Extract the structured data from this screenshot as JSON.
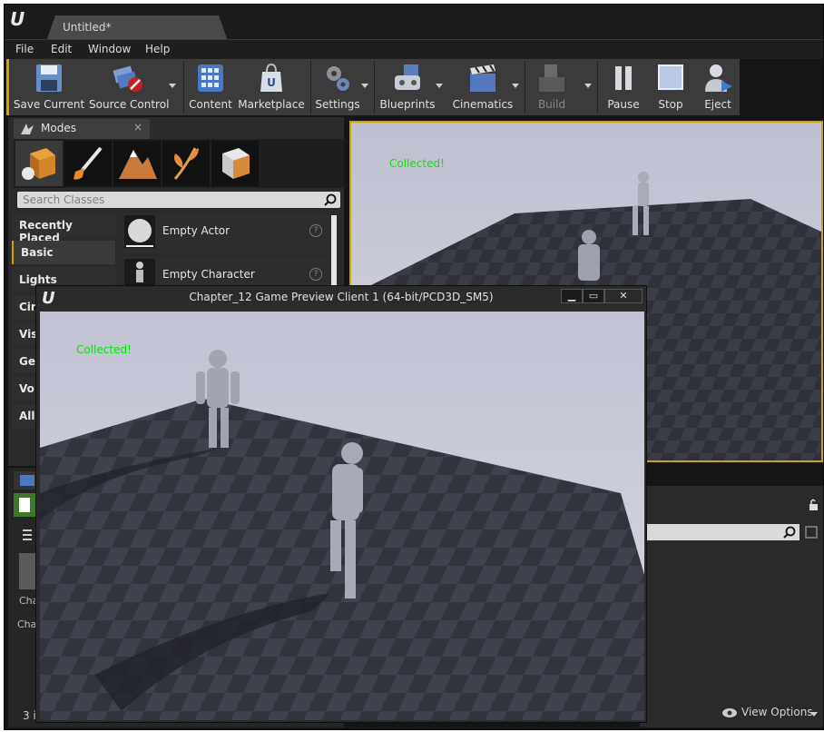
{
  "app": {
    "logo_text": "U",
    "document_tab": "Untitled*"
  },
  "menu": [
    "File",
    "Edit",
    "Window",
    "Help"
  ],
  "toolbar": {
    "buttons": [
      {
        "label": "Save Current",
        "icon": "floppy-disk-icon"
      },
      {
        "label": "Source Control",
        "icon": "source-control-icon"
      },
      {
        "label": "Content",
        "icon": "content-grid-icon"
      },
      {
        "label": "Marketplace",
        "icon": "marketplace-bag-icon"
      },
      {
        "label": "Settings",
        "icon": "gears-icon"
      },
      {
        "label": "Blueprints",
        "icon": "gamepad-icon"
      },
      {
        "label": "Cinematics",
        "icon": "clapperboard-icon"
      },
      {
        "label": "Build",
        "icon": "build-blocks-icon"
      },
      {
        "label": "Pause",
        "icon": "pause-icon"
      },
      {
        "label": "Stop",
        "icon": "stop-icon"
      },
      {
        "label": "Eject",
        "icon": "eject-user-icon"
      }
    ]
  },
  "modes": {
    "tab_title": "Modes",
    "close": "×",
    "search_placeholder": "Search Classes",
    "categories": [
      "Recently Placed",
      "Basic",
      "Lights",
      "Cin",
      "Vis",
      "Ge",
      "Vo",
      "All"
    ],
    "items": [
      {
        "label": "Empty Actor",
        "help": "?"
      },
      {
        "label": "Empty Character",
        "help": "?"
      }
    ]
  },
  "viewport": {
    "message": "Collected!"
  },
  "content_browser": {
    "item_count_text": "3 i",
    "asset_label_1": "Cha",
    "asset_label_2": "Cha",
    "view_options": "View Options"
  },
  "preview_window": {
    "logo_text": "U",
    "title": "Chapter_12 Game Preview Client 1 (64-bit/PCD3D_SM5)",
    "message": "Collected!",
    "min": "▁",
    "max": "▭",
    "close": "✕"
  },
  "colors": {
    "accent": "#d1a400",
    "message_green": "#00e800"
  }
}
